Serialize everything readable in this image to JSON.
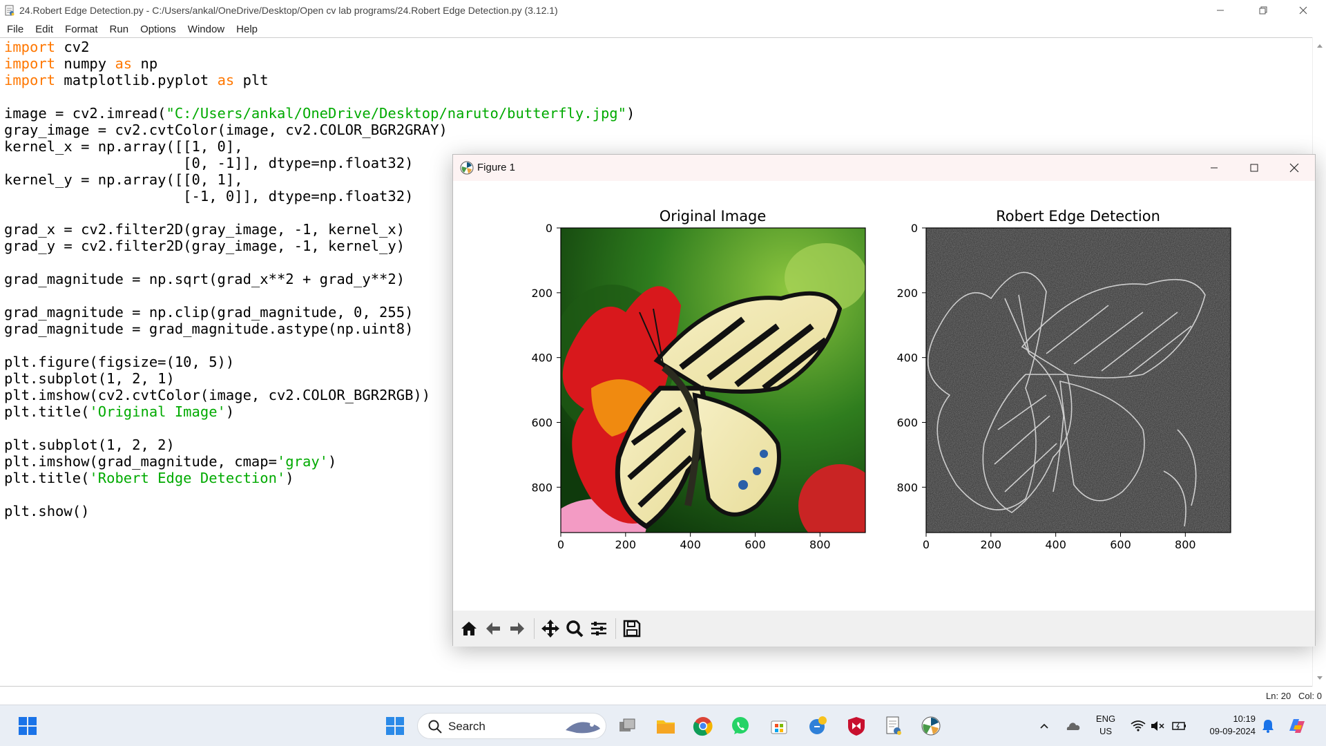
{
  "idle": {
    "title": "24.Robert Edge Detection.py - C:/Users/ankal/OneDrive/Desktop/Open cv lab programs/24.Robert Edge Detection.py (3.12.1)",
    "menu": [
      "File",
      "Edit",
      "Format",
      "Run",
      "Options",
      "Window",
      "Help"
    ],
    "status_line": "Ln: 20",
    "status_col": "Col: 0",
    "code": [
      [
        {
          "t": "import",
          "c": "kw"
        },
        {
          "t": " cv2",
          "c": ""
        }
      ],
      [
        {
          "t": "import",
          "c": "kw"
        },
        {
          "t": " numpy ",
          "c": ""
        },
        {
          "t": "as",
          "c": "kw"
        },
        {
          "t": " np",
          "c": ""
        }
      ],
      [
        {
          "t": "import",
          "c": "kw"
        },
        {
          "t": " matplotlib.pyplot ",
          "c": ""
        },
        {
          "t": "as",
          "c": "kw"
        },
        {
          "t": " plt",
          "c": ""
        }
      ],
      [],
      [
        {
          "t": "image = cv2.imread(",
          "c": ""
        },
        {
          "t": "\"C:/Users/ankal/OneDrive/Desktop/naruto/butterfly.jpg\"",
          "c": "str"
        },
        {
          "t": ")",
          "c": ""
        }
      ],
      [
        {
          "t": "gray_image = cv2.cvtColor(image, cv2.COLOR_BGR2GRAY)",
          "c": ""
        }
      ],
      [
        {
          "t": "kernel_x = np.array([[1, 0],",
          "c": ""
        }
      ],
      [
        {
          "t": "                     [0, -1]], dtype=np.float32)",
          "c": ""
        }
      ],
      [
        {
          "t": "kernel_y = np.array([[0, 1],",
          "c": ""
        }
      ],
      [
        {
          "t": "                     [-1, 0]], dtype=np.float32)",
          "c": ""
        }
      ],
      [],
      [
        {
          "t": "grad_x = cv2.filter2D(gray_image, -1, kernel_x)",
          "c": ""
        }
      ],
      [
        {
          "t": "grad_y = cv2.filter2D(gray_image, -1, kernel_y)",
          "c": ""
        }
      ],
      [],
      [
        {
          "t": "grad_magnitude = np.sqrt(grad_x**2 + grad_y**2)",
          "c": ""
        }
      ],
      [],
      [
        {
          "t": "grad_magnitude = np.clip(grad_magnitude, 0, 255)",
          "c": ""
        }
      ],
      [
        {
          "t": "grad_magnitude = grad_magnitude.astype(np.uint8)",
          "c": ""
        }
      ],
      [],
      [
        {
          "t": "plt.figure(figsize=(10, 5))",
          "c": ""
        }
      ],
      [
        {
          "t": "plt.subplot(1, 2, 1)",
          "c": ""
        }
      ],
      [
        {
          "t": "plt.imshow(cv2.cvtColor(image, cv2.COLOR_BGR2RGB))",
          "c": ""
        }
      ],
      [
        {
          "t": "plt.title(",
          "c": ""
        },
        {
          "t": "'Original Image'",
          "c": "str"
        },
        {
          "t": ")",
          "c": ""
        }
      ],
      [],
      [
        {
          "t": "plt.subplot(1, 2, 2)",
          "c": ""
        }
      ],
      [
        {
          "t": "plt.imshow(grad_magnitude, cmap=",
          "c": ""
        },
        {
          "t": "'gray'",
          "c": "str"
        },
        {
          "t": ")",
          "c": ""
        }
      ],
      [
        {
          "t": "plt.title(",
          "c": ""
        },
        {
          "t": "'Robert Edge Detection'",
          "c": "str"
        },
        {
          "t": ")",
          "c": ""
        }
      ],
      [],
      [
        {
          "t": "plt.show()",
          "c": ""
        }
      ]
    ]
  },
  "figure": {
    "title": "Figure 1",
    "toolbar_icons": [
      "home-icon",
      "back-icon",
      "forward-icon",
      "pan-icon",
      "zoom-icon",
      "configure-subplots-icon",
      "save-icon"
    ],
    "plots": [
      {
        "title": "Original Image",
        "xticks": [
          "0",
          "200",
          "400",
          "600",
          "800"
        ],
        "yticks": [
          "0",
          "200",
          "400",
          "600",
          "800"
        ],
        "content": "butterfly photo"
      },
      {
        "title": "Robert Edge Detection",
        "xticks": [
          "0",
          "200",
          "400",
          "600",
          "800"
        ],
        "yticks": [
          "0",
          "200",
          "400",
          "600",
          "800"
        ],
        "content": "edge map"
      }
    ]
  },
  "taskbar": {
    "search_label": "Search",
    "lang_top": "ENG",
    "lang_bottom": "US",
    "time": "10:19",
    "date": "09-09-2024"
  }
}
